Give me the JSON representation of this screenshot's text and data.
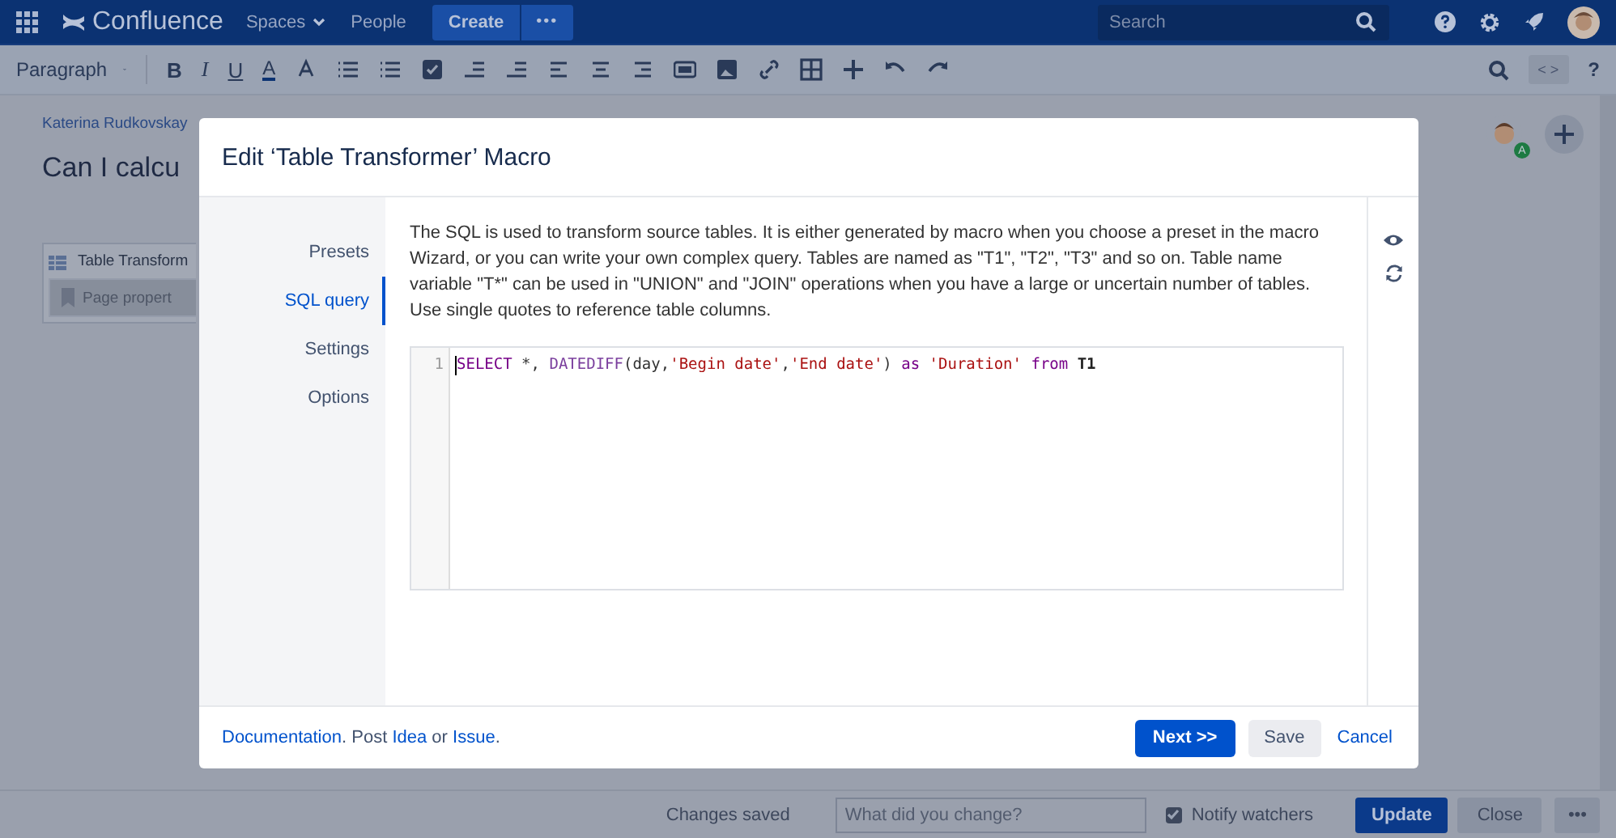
{
  "topnav": {
    "logo": "Confluence",
    "items": [
      {
        "label": "Spaces",
        "dropdown": true
      },
      {
        "label": "People",
        "dropdown": false
      }
    ],
    "create": "Create",
    "more": "•••",
    "search": {
      "placeholder": "Search"
    }
  },
  "toolbar": {
    "style": "Paragraph",
    "format": [
      "B",
      "I",
      "U"
    ],
    "color_letter": "A",
    "code_toggle": "< >",
    "help": "?"
  },
  "page": {
    "breadcrumb": "Katerina Rudkovskay",
    "title": "Can I calcu",
    "macro": {
      "name": "Table Transform",
      "inner": "Page propert"
    },
    "avatar_badge": "A"
  },
  "dialog": {
    "title": "Edit ‘Table Transformer’ Macro",
    "nav": [
      {
        "label": "Presets",
        "selected": false
      },
      {
        "label": "SQL query",
        "selected": true
      },
      {
        "label": "Settings",
        "selected": false
      },
      {
        "label": "Options",
        "selected": false
      }
    ],
    "description": "The SQL is used to transform source tables. It is either generated by macro when you choose a preset in the macro Wizard, or you can write your own complex query. Tables are named as \"T1\", \"T2\", \"T3\" and so on. Table name variable \"T*\" can be used in \"UNION\" and \"JOIN\" operations when you have a large or uncertain number of tables. Use single quotes to reference table columns.",
    "editor": {
      "lines": [
        {
          "number": "1",
          "tokens": [
            {
              "kind": "keyword",
              "text": "SELECT"
            },
            {
              "kind": "plain",
              "text": " *, "
            },
            {
              "kind": "function",
              "text": "DATEDIFF"
            },
            {
              "kind": "plain",
              "text": "(day,"
            },
            {
              "kind": "string",
              "text": "'Begin date'"
            },
            {
              "kind": "plain",
              "text": ","
            },
            {
              "kind": "string",
              "text": "'End date'"
            },
            {
              "kind": "plain",
              "text": ") "
            },
            {
              "kind": "keyword",
              "text": "as "
            },
            {
              "kind": "string",
              "text": "'Duration' "
            },
            {
              "kind": "keyword",
              "text": "from "
            },
            {
              "kind": "table",
              "text": "T1"
            }
          ]
        }
      ]
    },
    "footer_links": [
      {
        "kind": "link",
        "text": "Documentation"
      },
      {
        "kind": "text",
        "text": ". Post "
      },
      {
        "kind": "link",
        "text": "Idea"
      },
      {
        "kind": "text",
        "text": " or "
      },
      {
        "kind": "link",
        "text": "Issue"
      },
      {
        "kind": "text",
        "text": "."
      }
    ],
    "buttons": {
      "next": "Next >>",
      "save": "Save",
      "cancel": "Cancel"
    }
  },
  "bottom_bar": {
    "status": "Changes saved",
    "comment": {
      "placeholder": "What did you change?"
    },
    "notify": {
      "label": "Notify watchers",
      "checked": true
    },
    "update": "Update",
    "close": "Close",
    "more": "•••"
  }
}
